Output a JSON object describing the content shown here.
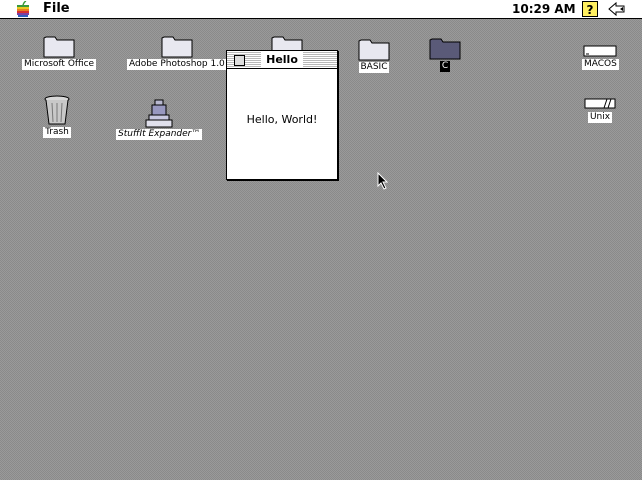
{
  "menubar": {
    "apple_icon": "apple-logo-icon",
    "menus": [
      "File"
    ],
    "clock": "10:29 AM",
    "help_icon": "help-question-icon",
    "app_menu_icon": "application-menu-icon"
  },
  "desktop": {
    "icons": [
      {
        "label": "Microsoft Office",
        "icon": "folder-icon"
      },
      {
        "label": "Adobe Photoshop 1.0",
        "icon": "folder-icon"
      },
      {
        "label": "BASIC",
        "icon": "folder-icon"
      },
      {
        "label": "C",
        "icon": "folder-icon",
        "selected": true
      },
      {
        "label": "MACOS",
        "icon": "disk-icon"
      },
      {
        "label": "Trash",
        "icon": "trash-icon"
      },
      {
        "label": "StuffIt Expander™",
        "icon": "stuffit-icon"
      },
      {
        "label": "Unix",
        "icon": "disk-icon"
      }
    ]
  },
  "window": {
    "title": "Hello",
    "body_text": "Hello, World!"
  }
}
